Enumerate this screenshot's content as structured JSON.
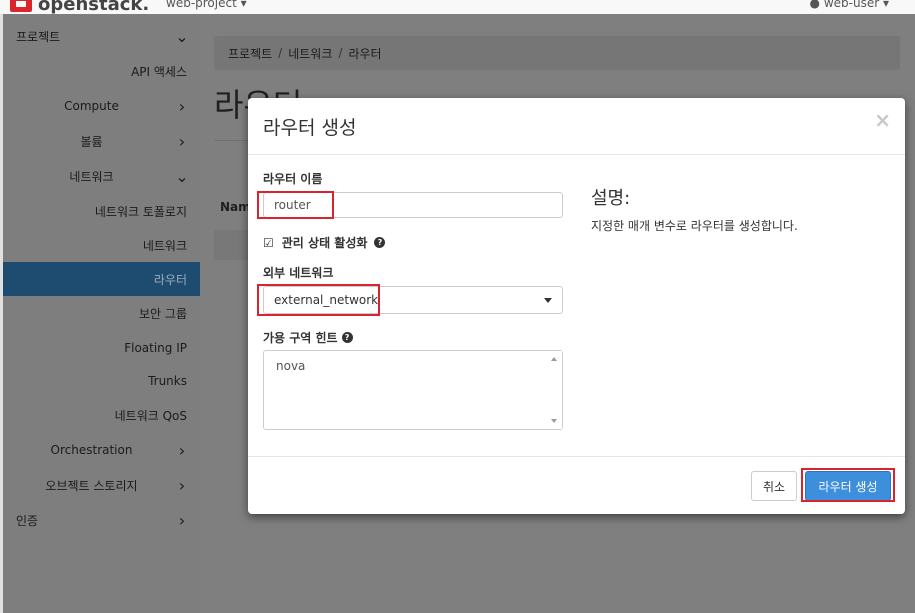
{
  "navbar": {
    "logo_text": "openstack.",
    "project_label": "web-project ▾",
    "user_label": "● web-user ▾"
  },
  "sidebar": {
    "items": [
      {
        "label": "프로젝트",
        "chevron": "⌄"
      },
      {
        "label": "API 액세스"
      },
      {
        "label": "Compute",
        "chevron": "›"
      },
      {
        "label": "볼륨",
        "chevron": "›"
      },
      {
        "label": "네트워크",
        "chevron": "⌄"
      },
      {
        "label": "네트워크 토폴로지"
      },
      {
        "label": "네트워크"
      },
      {
        "label": "라우터"
      },
      {
        "label": "보안 그룹"
      },
      {
        "label": "Floating IP"
      },
      {
        "label": "Trunks"
      },
      {
        "label": "네트워크 QoS"
      },
      {
        "label": "Orchestration",
        "chevron": "›"
      },
      {
        "label": "오브젝트 스토리지",
        "chevron": "›"
      },
      {
        "label": "인증",
        "chevron": "›"
      }
    ]
  },
  "breadcrumb": {
    "items": [
      "프로젝트",
      "네트워크",
      "라우터"
    ],
    "separator": "/"
  },
  "page": {
    "title": "라우터",
    "table_header_name": "Name"
  },
  "modal": {
    "title": "라우터 생성",
    "close_icon": "×",
    "router_name_label": "라우터 이름",
    "router_name_value": "router",
    "admin_state_label": "관리 상태 활성화",
    "admin_state_checked": true,
    "external_network_label": "외부 네트워크",
    "external_network_value": "external_network",
    "az_hint_label": "가용 구역 힌트",
    "az_hint_value": "nova",
    "description_title": "설명:",
    "description_text": "지정한 매개 변수로 라우터를 생성합니다.",
    "cancel_label": "취소",
    "submit_label": "라우터 생성"
  },
  "colors": {
    "accent": "#3d8edb",
    "highlight": "#d9232e",
    "sidebar_active": "#1d4c70"
  }
}
